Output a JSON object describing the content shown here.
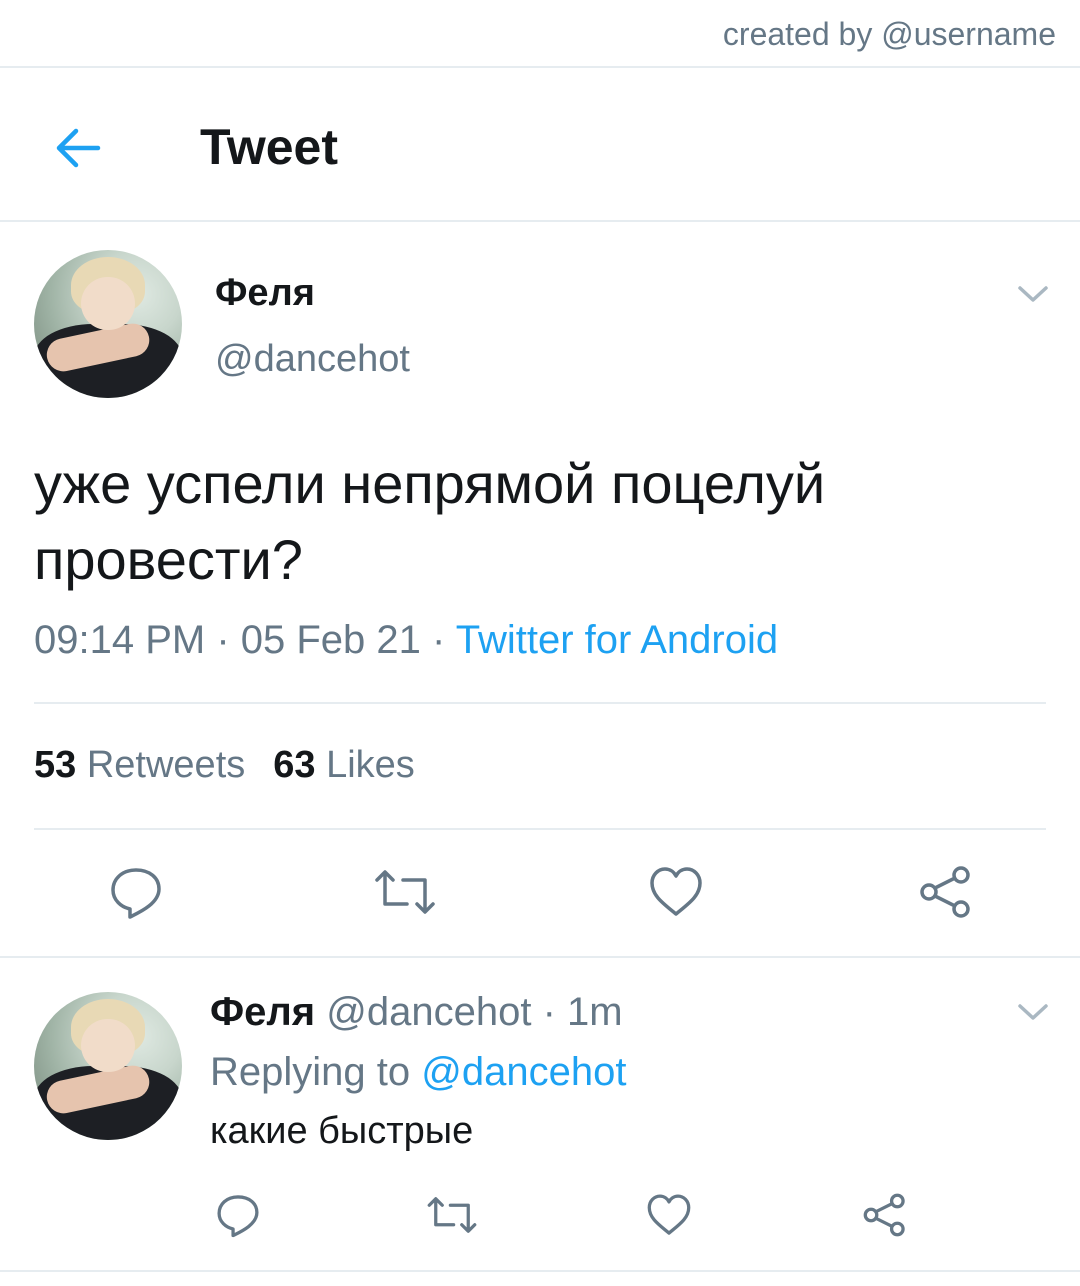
{
  "watermark": "created by @username",
  "header": {
    "title": "Tweet",
    "back_icon": "arrow-left-icon"
  },
  "colors": {
    "accent": "#1da1f2",
    "secondary_text": "#657786",
    "primary_text": "#14171a",
    "divider": "#e6ecf0"
  },
  "tweet": {
    "author_name": "Феля",
    "author_handle": "@dancehot",
    "text": "уже успели непрямой поцелуй провести?",
    "time": "09:14 PM",
    "sep1": " · ",
    "date": "05 Feb 21",
    "sep2": " · ",
    "source": "Twitter for Android",
    "retweets_count": "53",
    "retweets_label": "Retweets",
    "likes_count": "63",
    "likes_label": "Likes",
    "actions": [
      "reply-icon",
      "retweet-icon",
      "like-icon",
      "share-icon"
    ]
  },
  "reply": {
    "author_name": "Феля",
    "author_handle": "@dancehot",
    "time_sep": " · ",
    "time": "1m",
    "replying_label": "Replying to ",
    "replying_to": "@dancehot",
    "text": "какие быстрые",
    "actions": [
      "reply-icon",
      "retweet-icon",
      "like-icon",
      "share-icon"
    ]
  }
}
